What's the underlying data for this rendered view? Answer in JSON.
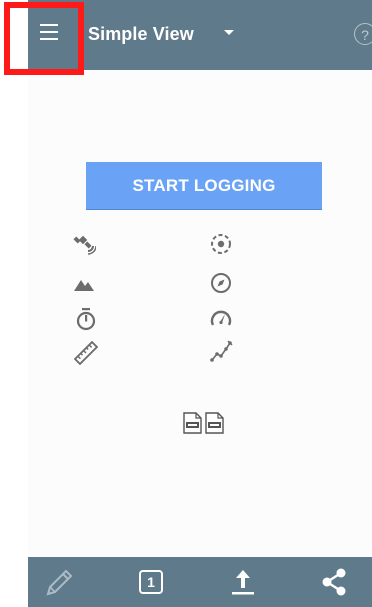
{
  "toolbar": {
    "view_title": "Simple View",
    "help_label": "?"
  },
  "main": {
    "start_button_label": "START LOGGING",
    "status_icons": [
      "satellite-icon",
      "fix-icon",
      "altitude-icon",
      "compass-icon",
      "timer-icon",
      "speed-icon",
      "distance-icon",
      "track-icon"
    ],
    "file_icons": [
      "gpx-file-icon",
      "csv-file-icon"
    ]
  },
  "bottom_bar": {
    "counter_value": "1",
    "items": [
      "pencil-icon",
      "counter-badge",
      "upload-icon",
      "share-icon"
    ]
  },
  "colors": {
    "toolbar_bg": "#5f7a8a",
    "accent_button": "#6aa2f5",
    "icon_gray": "#6c6c6c",
    "highlight": "#ff1a1a"
  }
}
